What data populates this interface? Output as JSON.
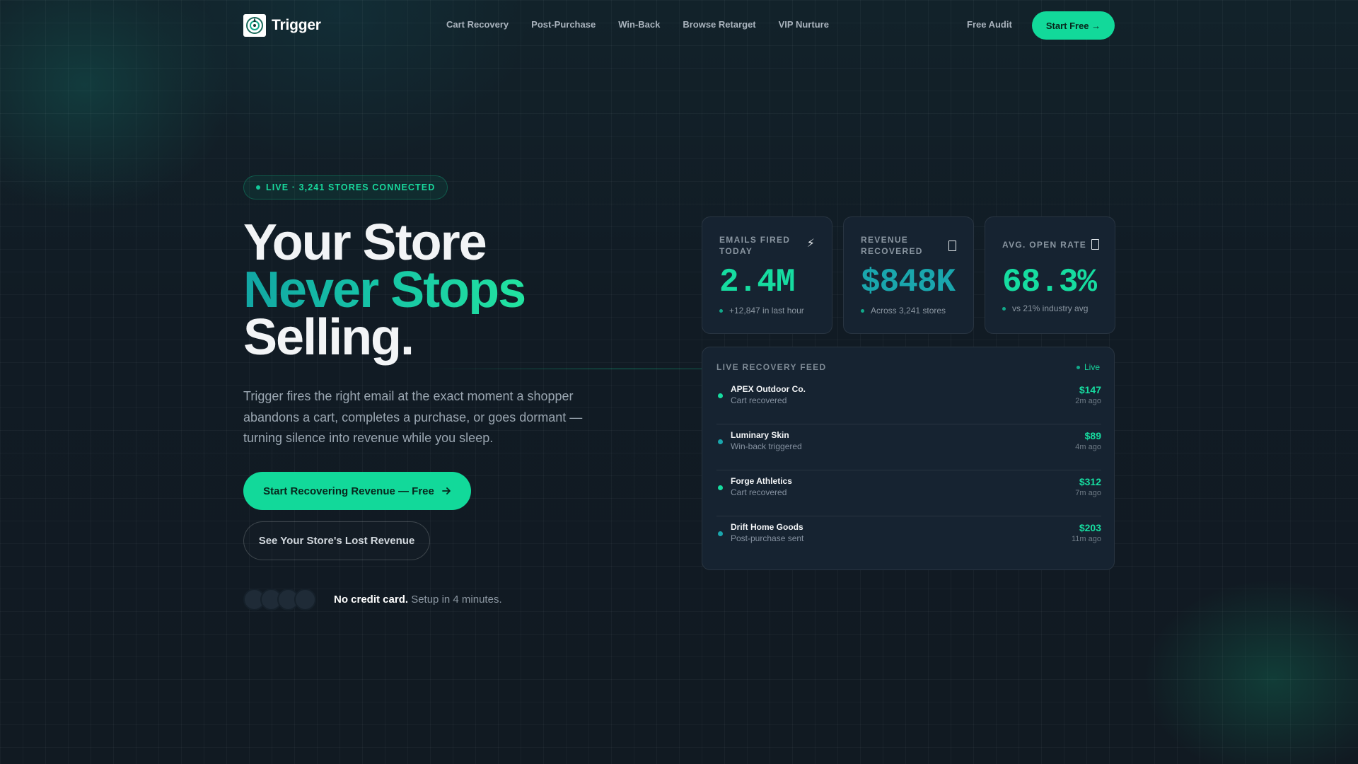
{
  "brand": {
    "name": "Trigger"
  },
  "nav": {
    "items": [
      "Cart Recovery",
      "Post-Purchase",
      "Win-Back",
      "Browse Retarget",
      "VIP Nurture"
    ],
    "free_audit": "Free Audit",
    "start_free": "Start Free →"
  },
  "hero": {
    "badge": "LIVE · 3,241 STORES CONNECTED",
    "headline_1": "Your Store",
    "headline_2": "Never Stops",
    "headline_3": "Selling.",
    "subtitle": "Trigger fires the right email at the exact moment a shopper abandons a cart, completes a purchase, or goes dormant — turning silence into revenue while you sleep.",
    "cta_primary": "Start Recovering Revenue — Free",
    "cta_secondary": "See Your Store's Lost Revenue",
    "note_bold": "No credit card.",
    "note_rest": "Setup in 4 minutes."
  },
  "stats": [
    {
      "label": "EMAILS FIRED TODAY",
      "value": "2.4M",
      "foot": "+12,847 in last hour",
      "icon": "lightning-icon"
    },
    {
      "label": "REVENUE RECOVERED",
      "value": "$848K",
      "foot": "Across 3,241 stores",
      "icon": "document-icon"
    },
    {
      "label": "AVG. OPEN RATE",
      "value": "68.3%",
      "foot": "vs 21% industry avg",
      "icon": "document-icon"
    }
  ],
  "feed": {
    "title": "LIVE RECOVERY FEED",
    "live": "Live",
    "rows": [
      {
        "name": "APEX Outdoor Co.",
        "desc": "Cart recovered",
        "amount": "$147",
        "time": "2m ago",
        "color": "#16dca0"
      },
      {
        "name": "Luminary Skin",
        "desc": "Win-back triggered",
        "amount": "$89",
        "time": "4m ago",
        "color": "#1aa6ad"
      },
      {
        "name": "Forge Athletics",
        "desc": "Cart recovered",
        "amount": "$312",
        "time": "7m ago",
        "color": "#16dca0"
      },
      {
        "name": "Drift Home Goods",
        "desc": "Post-purchase sent",
        "amount": "$203",
        "time": "11m ago",
        "color": "#1aa6ad"
      }
    ]
  },
  "colors": {
    "accent": "#12d99a",
    "accent_teal": "#1aa6ad",
    "background": "#111a22",
    "card": "#162331"
  }
}
